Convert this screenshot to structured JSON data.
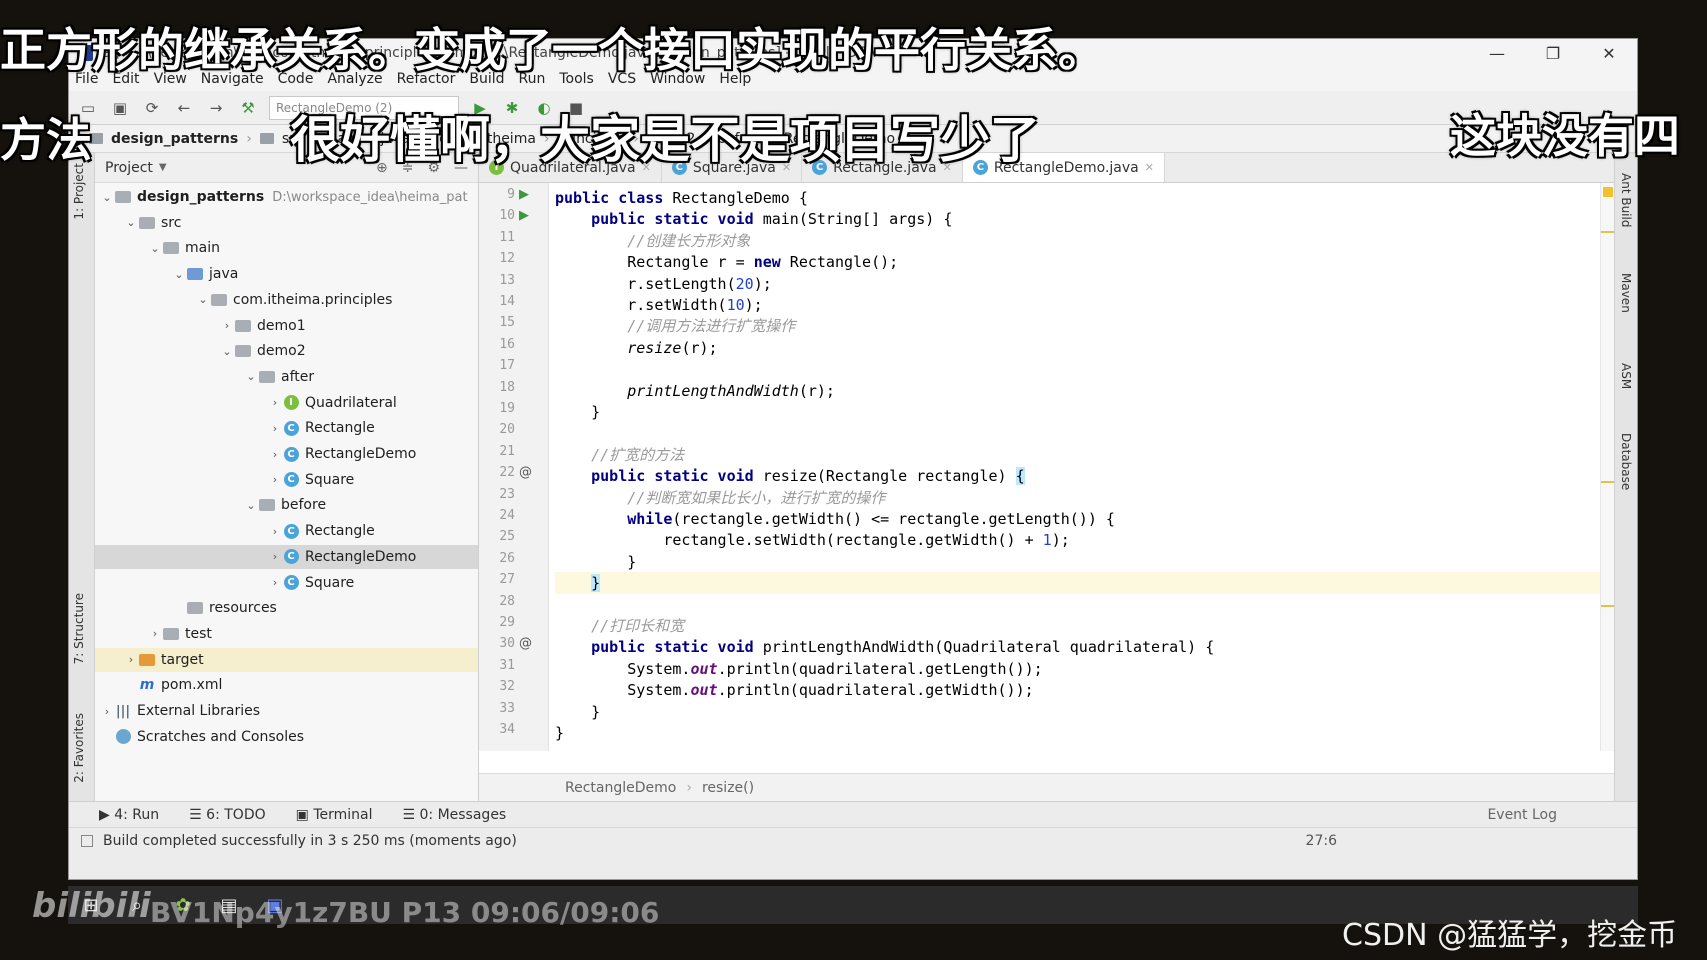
{
  "window": {
    "title": "e ] - ...\\des    rc\\main\\java\\com\\itheima\\principles\\demo2\\...\\RectangleDemo.java [design_patterns] - IntelliJ IDEA",
    "controls": [
      "—",
      "❐",
      "✕"
    ]
  },
  "menu": [
    "File",
    "Edit",
    "View",
    "Navigate",
    "Code",
    "Analyze",
    "Refactor",
    "Build",
    "Run",
    "Tools",
    "VCS",
    "Window",
    "Help"
  ],
  "toolbar": {
    "run_config": "RectangleDemo (2)"
  },
  "navbar": {
    "project": "design_patterns",
    "items": [
      "src",
      "main",
      "java",
      "com",
      "itheima",
      "principles",
      "demo2",
      "before",
      "RectangleDemo"
    ]
  },
  "left_tabs": [
    "1: Project",
    "7: Structure",
    "2: Favorites"
  ],
  "project_panel": {
    "header": "Project",
    "tree": [
      {
        "label": "design_patterns",
        "hint": "D:\\workspace_idea\\heima_pat",
        "icon": "folder",
        "depth": 0,
        "arrow": "down",
        "bold": true
      },
      {
        "label": "src",
        "icon": "folder",
        "depth": 1,
        "arrow": "down"
      },
      {
        "label": "main",
        "icon": "folder",
        "depth": 2,
        "arrow": "down"
      },
      {
        "label": "java",
        "icon": "folder-blue",
        "depth": 3,
        "arrow": "down"
      },
      {
        "label": "com.itheima.principles",
        "icon": "folder",
        "depth": 4,
        "arrow": "down"
      },
      {
        "label": "demo1",
        "icon": "folder",
        "depth": 5,
        "arrow": "right"
      },
      {
        "label": "demo2",
        "icon": "folder",
        "depth": 5,
        "arrow": "down"
      },
      {
        "label": "after",
        "icon": "folder",
        "depth": 6,
        "arrow": "down"
      },
      {
        "label": "Quadrilateral",
        "icon": "interface",
        "depth": 7,
        "arrow": "right"
      },
      {
        "label": "Rectangle",
        "icon": "class",
        "depth": 7,
        "arrow": "right"
      },
      {
        "label": "RectangleDemo",
        "icon": "class",
        "depth": 7,
        "arrow": "right"
      },
      {
        "label": "Square",
        "icon": "class",
        "depth": 7,
        "arrow": "right"
      },
      {
        "label": "before",
        "icon": "folder",
        "depth": 6,
        "arrow": "down"
      },
      {
        "label": "Rectangle",
        "icon": "class",
        "depth": 7,
        "arrow": "right"
      },
      {
        "label": "RectangleDemo",
        "icon": "class",
        "depth": 7,
        "arrow": "right",
        "selected": true
      },
      {
        "label": "Square",
        "icon": "class",
        "depth": 7,
        "arrow": "right"
      },
      {
        "label": "resources",
        "icon": "folder",
        "depth": 3,
        "arrow": ""
      },
      {
        "label": "test",
        "icon": "folder",
        "depth": 2,
        "arrow": "right"
      },
      {
        "label": "target",
        "icon": "folder-orange",
        "depth": 1,
        "arrow": "right",
        "highlight": true
      },
      {
        "label": "pom.xml",
        "icon": "maven",
        "depth": 1,
        "arrow": ""
      },
      {
        "label": "External Libraries",
        "icon": "library",
        "depth": 0,
        "arrow": "right"
      },
      {
        "label": "Scratches and Consoles",
        "icon": "scratch",
        "depth": 0,
        "arrow": ""
      }
    ]
  },
  "tabs": [
    {
      "label": "Quadrilateral.java",
      "icon": "interface"
    },
    {
      "label": "Square.java",
      "icon": "class"
    },
    {
      "label": "Rectangle.java",
      "icon": "class"
    },
    {
      "label": "RectangleDemo.java",
      "icon": "class",
      "active": true
    }
  ],
  "code_lines": [
    {
      "n": "9",
      "mark": "▶",
      "html": "<span class=\"kw\">public class</span> RectangleDemo {"
    },
    {
      "n": "10",
      "mark": "▶",
      "html": "    <span class=\"kw\">public static void</span> main(String[] args) {"
    },
    {
      "n": "11",
      "mark": "",
      "html": "        <span class=\"cm\">//创建长方形对象</span>"
    },
    {
      "n": "12",
      "mark": "",
      "html": "        Rectangle r = <span class=\"kw\">new</span> Rectangle();"
    },
    {
      "n": "13",
      "mark": "",
      "html": "        r.setLength(<span class=\"num\">20</span>);"
    },
    {
      "n": "14",
      "mark": "",
      "html": "        r.setWidth(<span class=\"num\">10</span>);"
    },
    {
      "n": "15",
      "mark": "",
      "html": "        <span class=\"cm\">//调用方法进行扩宽操作</span>"
    },
    {
      "n": "16",
      "mark": "",
      "html": "        <span class=\"it\">resize</span>(r);"
    },
    {
      "n": "17",
      "mark": "",
      "html": ""
    },
    {
      "n": "18",
      "mark": "",
      "html": "        <span class=\"it\">printLengthAndWidth</span>(r);"
    },
    {
      "n": "19",
      "mark": "",
      "html": "    }"
    },
    {
      "n": "20",
      "mark": "",
      "html": ""
    },
    {
      "n": "21",
      "mark": "",
      "html": "    <span class=\"cm\">//扩宽的方法</span>"
    },
    {
      "n": "22",
      "mark": "@",
      "html": "    <span class=\"kw\">public static void</span> resize(Rectangle rectangle) <span class=\"brace\">{</span>"
    },
    {
      "n": "23",
      "mark": "",
      "html": "        <span class=\"cm\">//判断宽如果比长小，进行扩宽的操作</span>"
    },
    {
      "n": "24",
      "mark": "",
      "html": "        <span class=\"kw\">while</span>(rectangle.getWidth() &lt;= rectangle.getLength()) {"
    },
    {
      "n": "25",
      "mark": "",
      "html": "            rectangle.setWidth(rectangle.getWidth() + <span class=\"num\">1</span>);"
    },
    {
      "n": "26",
      "mark": "",
      "html": "        }"
    },
    {
      "n": "27",
      "mark": "",
      "html": "    <span class=\"brace\">}</span>",
      "current": true
    },
    {
      "n": "28",
      "mark": "",
      "html": ""
    },
    {
      "n": "29",
      "mark": "",
      "html": "    <span class=\"cm\">//打印长和宽</span>"
    },
    {
      "n": "30",
      "mark": "@",
      "html": "    <span class=\"kw\">public static void</span> printLengthAndWidth(Quadrilateral quadrilateral) {"
    },
    {
      "n": "31",
      "mark": "",
      "html": "        System.<span class=\"field\">out</span>.println(quadrilateral.getLength());"
    },
    {
      "n": "32",
      "mark": "",
      "html": "        System.<span class=\"field\">out</span>.println(quadrilateral.getWidth());"
    },
    {
      "n": "33",
      "mark": "",
      "html": "    }"
    },
    {
      "n": "34",
      "mark": "",
      "html": "}"
    }
  ],
  "breadcrumb": [
    "RectangleDemo",
    "resize()"
  ],
  "right_tabs": [
    "Ant Build",
    "Maven",
    "ASM",
    "Database"
  ],
  "bottom_tools": [
    {
      "icon": "▶",
      "label": "4: Run"
    },
    {
      "icon": "☰",
      "label": "6: TODO"
    },
    {
      "icon": "▣",
      "label": "Terminal"
    },
    {
      "icon": "☰",
      "label": "0: Messages"
    }
  ],
  "status": {
    "message": "Build completed successfully in 3 s 250 ms (moments ago)",
    "position": "27:6",
    "event_log": "Event Log"
  },
  "subtitles": {
    "top": "正方形的继承关系。变成了一个接口实现的平行关系。",
    "middle": "很好懂啊，大家是不是项目写少了",
    "left": "方法",
    "right": "这块没有四"
  },
  "watermarks": {
    "video": "BV1Np4y1z7BU P13 09:06/09:06",
    "csdn": "CSDN @猛猛学，挖金币",
    "bilibili": "bilibili"
  }
}
